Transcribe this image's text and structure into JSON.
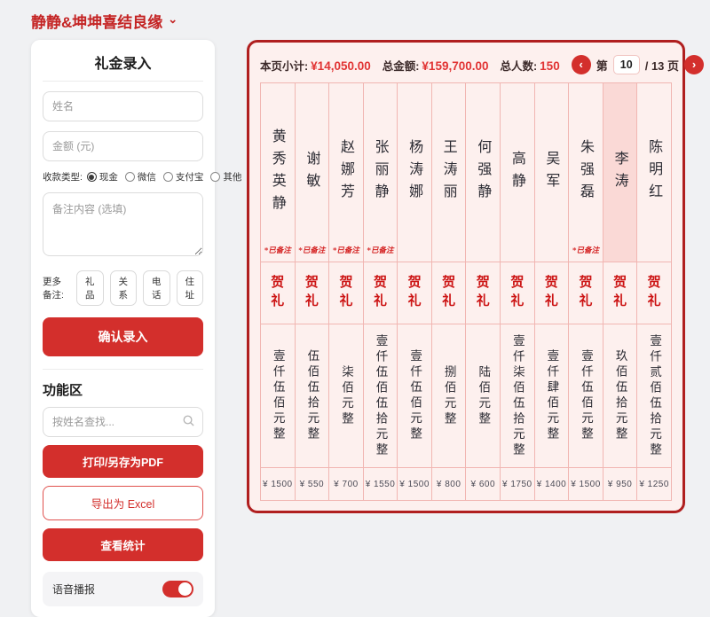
{
  "app": {
    "title": "静静&坤坤喜结良缘"
  },
  "icons": {
    "dropdown": "⌄",
    "prev": "‹",
    "next": "›"
  },
  "form": {
    "title": "礼金录入",
    "name_placeholder": "姓名",
    "amount_placeholder": "金额 (元)",
    "payment_label": "收款类型:",
    "payment_options": [
      {
        "label": "现金",
        "selected": true
      },
      {
        "label": "微信",
        "selected": false
      },
      {
        "label": "支付宝",
        "selected": false
      },
      {
        "label": "其他",
        "selected": false
      }
    ],
    "remark_placeholder": "备注内容 (选填)",
    "more_remarks_label": "更多备注:",
    "remark_chips": [
      "礼品",
      "关系",
      "电话",
      "住址"
    ],
    "submit_label": "确认录入"
  },
  "tools": {
    "title": "功能区",
    "search_placeholder": "按姓名查找...",
    "print_label": "打印/另存为PDF",
    "export_label": "导出为 Excel",
    "stats_label": "查看统计",
    "voice_label": "语音播报",
    "voice_on": true
  },
  "ledger": {
    "subtotal_label": "本页小计:",
    "subtotal_value": "¥14,050.00",
    "total_label": "总金额:",
    "total_value": "¥159,700.00",
    "count_label": "总人数:",
    "count_value": "150",
    "page_prefix": "第",
    "page_current": "10",
    "page_suffix": "/ 13 页",
    "gift_label": "贺礼",
    "noted_label": "*已备注",
    "accent_color": "#d32f2c",
    "columns": [
      {
        "name": "黄秀英静",
        "noted": true,
        "highlight": false,
        "amount_cn": "壹仟伍佰元整",
        "amount_num": "¥ 1500"
      },
      {
        "name": "谢敏",
        "noted": true,
        "highlight": false,
        "amount_cn": "伍佰伍拾元整",
        "amount_num": "¥ 550"
      },
      {
        "name": "赵娜芳",
        "noted": true,
        "highlight": false,
        "amount_cn": "柒佰元整",
        "amount_num": "¥ 700"
      },
      {
        "name": "张丽静",
        "noted": true,
        "highlight": false,
        "amount_cn": "壹仟伍佰伍拾元整",
        "amount_num": "¥ 1550"
      },
      {
        "name": "杨涛娜",
        "noted": false,
        "highlight": false,
        "amount_cn": "壹仟伍佰元整",
        "amount_num": "¥ 1500"
      },
      {
        "name": "王涛丽",
        "noted": false,
        "highlight": false,
        "amount_cn": "捌佰元整",
        "amount_num": "¥ 800"
      },
      {
        "name": "何强静",
        "noted": false,
        "highlight": false,
        "amount_cn": "陆佰元整",
        "amount_num": "¥ 600"
      },
      {
        "name": "高静",
        "noted": false,
        "highlight": false,
        "amount_cn": "壹仟柒佰伍拾元整",
        "amount_num": "¥ 1750"
      },
      {
        "name": "吴军",
        "noted": false,
        "highlight": false,
        "amount_cn": "壹仟肆佰元整",
        "amount_num": "¥ 1400"
      },
      {
        "name": "朱强磊",
        "noted": true,
        "highlight": false,
        "amount_cn": "壹仟伍佰元整",
        "amount_num": "¥ 1500"
      },
      {
        "name": "李涛",
        "noted": false,
        "highlight": true,
        "amount_cn": "玖佰伍拾元整",
        "amount_num": "¥ 950"
      },
      {
        "name": "陈明红",
        "noted": false,
        "highlight": false,
        "amount_cn": "壹仟贰佰伍拾元整",
        "amount_num": "¥ 1250"
      }
    ]
  }
}
